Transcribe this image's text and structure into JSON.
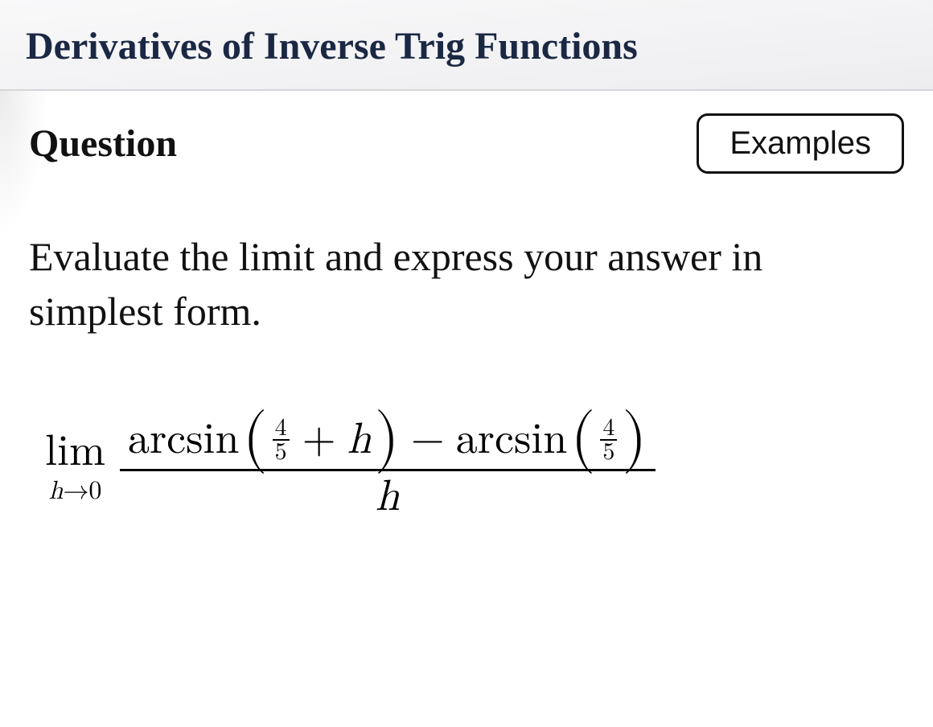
{
  "topic": "Derivatives of Inverse Trig Functions",
  "question_label": "Question",
  "examples_button": "Examples",
  "prompt": "Evaluate the limit and express your answer in simplest form.",
  "math": {
    "lim": "lim",
    "lim_var": "h",
    "lim_arrow": "→",
    "lim_target": "0",
    "fn": "arcsin",
    "inner_num": "4",
    "inner_den": "5",
    "plus": "+",
    "h": "h",
    "minus": "−",
    "denom": "h"
  }
}
